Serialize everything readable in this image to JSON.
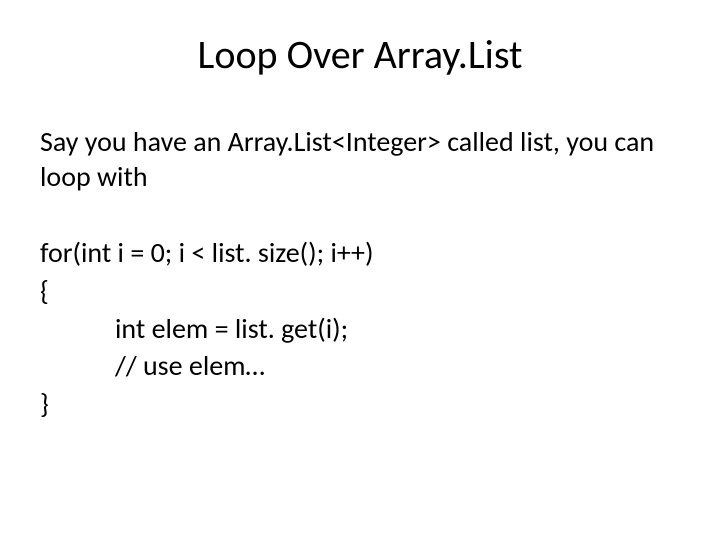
{
  "slide": {
    "title": "Loop Over Array.List",
    "intro": "Say you have an Array.List<Integer> called list, you can loop with",
    "code": {
      "line1": "for(int i = 0; i < list. size(); i++)",
      "line2": "{",
      "line3": "int elem = list. get(i);",
      "line4": "// use elem…",
      "line5": "}"
    }
  }
}
